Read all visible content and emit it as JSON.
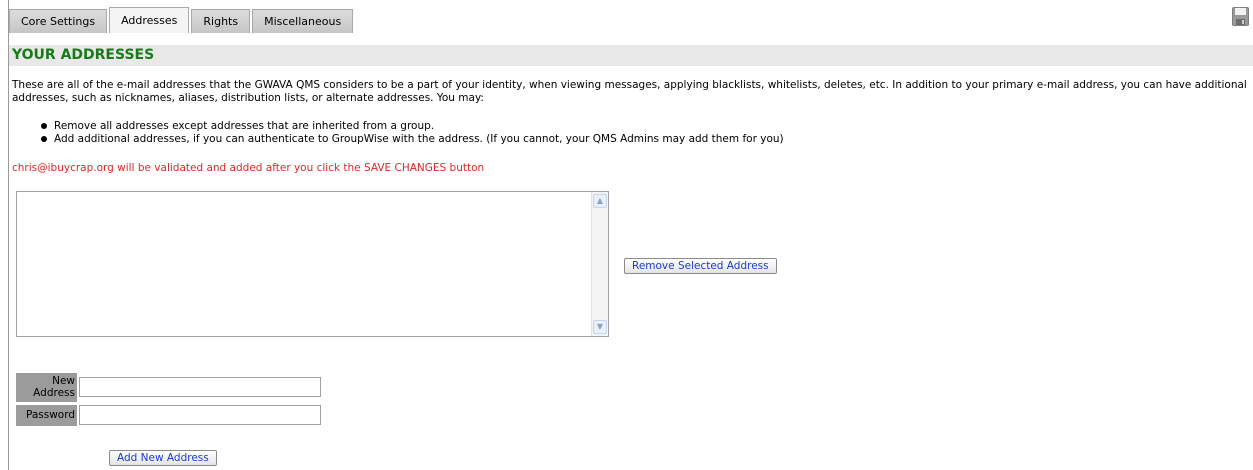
{
  "tabs": [
    {
      "label": "Core Settings",
      "active": false
    },
    {
      "label": "Addresses",
      "active": true
    },
    {
      "label": "Rights",
      "active": false
    },
    {
      "label": "Miscellaneous",
      "active": false
    }
  ],
  "section": {
    "title": "YOUR ADDRESSES"
  },
  "intro_text": "These are all of the e-mail addresses that the GWAVA QMS considers to be a part of your identity, when viewing messages, applying blacklists, whitelists, deletes, etc. In addition to your primary e-mail address, you can have additional addresses, such as nicknames, aliases, distribution lists, or alternate addresses. You may:",
  "bullets": [
    "Remove all addresses except addresses that are inherited from a group.",
    "Add additional addresses, if you can authenticate to GroupWise with the address. (If you cannot, your QMS Admins may add them for you)"
  ],
  "notice_text": "chris@ibuycrap.org will be validated and added after you click the SAVE CHANGES button",
  "address_list": {
    "items": []
  },
  "buttons": {
    "remove_label": "Remove Selected Address",
    "add_label": "Add New Address"
  },
  "form": {
    "new_address_label": "New Address",
    "new_address_value": "",
    "password_label": "Password",
    "password_value": ""
  },
  "colors": {
    "section_title": "#1a7a1a",
    "notice": "#e0262a",
    "button_text": "#1a3ccf"
  }
}
